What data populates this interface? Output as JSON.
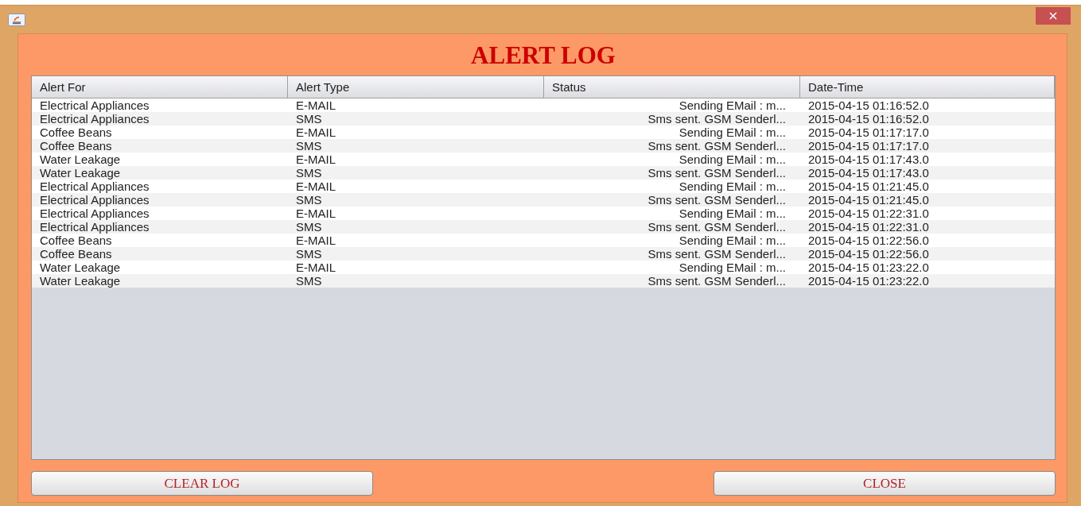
{
  "window": {
    "close": "×"
  },
  "title": "ALERT LOG",
  "table": {
    "columns": [
      "Alert For",
      "Alert Type",
      "Status",
      "Date-Time"
    ],
    "rows": [
      [
        "Electrical Appliances",
        "E-MAIL",
        "Sending EMail : m...",
        "2015-04-15 01:16:52.0"
      ],
      [
        "Electrical Appliances",
        "SMS",
        "Sms sent. GSM Senderl...",
        "2015-04-15 01:16:52.0"
      ],
      [
        "Coffee Beans",
        "E-MAIL",
        "Sending EMail : m...",
        "2015-04-15 01:17:17.0"
      ],
      [
        "Coffee Beans",
        "SMS",
        "Sms sent. GSM Senderl...",
        "2015-04-15 01:17:17.0"
      ],
      [
        "Water Leakage",
        "E-MAIL",
        "Sending EMail : m...",
        "2015-04-15 01:17:43.0"
      ],
      [
        "Water Leakage",
        "SMS",
        "Sms sent. GSM Senderl...",
        "2015-04-15 01:17:43.0"
      ],
      [
        "Electrical Appliances",
        "E-MAIL",
        "Sending EMail : m...",
        "2015-04-15 01:21:45.0"
      ],
      [
        "Electrical Appliances",
        "SMS",
        "Sms sent. GSM Senderl...",
        "2015-04-15 01:21:45.0"
      ],
      [
        "Electrical Appliances",
        "E-MAIL",
        "Sending EMail : m...",
        "2015-04-15 01:22:31.0"
      ],
      [
        "Electrical Appliances",
        "SMS",
        "Sms sent. GSM Senderl...",
        "2015-04-15 01:22:31.0"
      ],
      [
        "Coffee Beans",
        "E-MAIL",
        "Sending EMail : m...",
        "2015-04-15 01:22:56.0"
      ],
      [
        "Coffee Beans",
        "SMS",
        "Sms sent. GSM Senderl...",
        "2015-04-15 01:22:56.0"
      ],
      [
        "Water Leakage",
        "E-MAIL",
        "Sending EMail : m...",
        "2015-04-15 01:23:22.0"
      ],
      [
        "Water Leakage",
        "SMS",
        "Sms sent. GSM Senderl...",
        "2015-04-15 01:23:22.0"
      ]
    ]
  },
  "buttons": [
    "CLEAR LOG",
    "CLOSE"
  ]
}
